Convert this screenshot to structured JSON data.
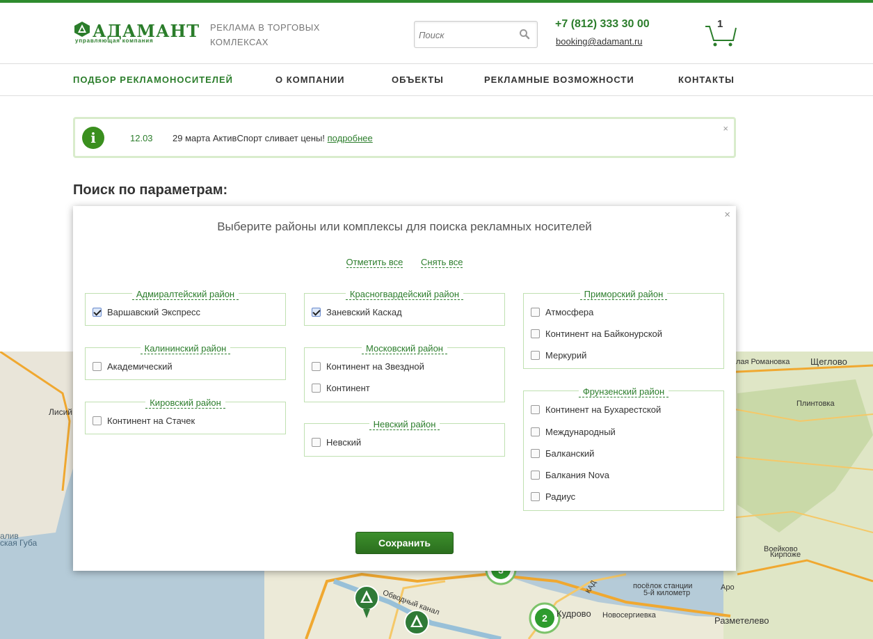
{
  "header": {
    "logo_name": "АДАМАНТ",
    "logo_sub": "управляющая компания",
    "tagline": "РЕКЛАМА В ТОРГОВЫХ КОМЛЕКСАХ",
    "search_placeholder": "Поиск",
    "phone": "+7 (812) 333 30 00",
    "email": "booking@adamant.ru",
    "cart_count": "1"
  },
  "nav": {
    "items": [
      {
        "label": "ПОДБОР РЕКЛАМОНОСИТЕЛЕЙ",
        "active": true
      },
      {
        "label": "О КОМПАНИИ",
        "active": false
      },
      {
        "label": "ОБЪЕКТЫ",
        "active": false
      },
      {
        "label": "РЕКЛАМНЫЕ ВОЗМОЖНОСТИ",
        "active": false
      },
      {
        "label": "КОНТАКТЫ",
        "active": false
      }
    ]
  },
  "notice": {
    "icon": "i",
    "date": "12.03",
    "message": "29 марта АктивСпорт сливает цены!",
    "more_link": "подробнее",
    "close": "×"
  },
  "section_title": "Поиск по параметрам:",
  "modal": {
    "close": "×",
    "title": "Выберите районы или комплексы для поиска рекламных носителей",
    "select_all": "Отметить все",
    "clear_all": "Снять все",
    "save_label": "Сохранить",
    "groups": [
      {
        "name": "Адмиралтейский район",
        "items": [
          {
            "label": "Варшавский Экспресс",
            "checked": true
          }
        ]
      },
      {
        "name": "Калининский район",
        "items": [
          {
            "label": "Академический",
            "checked": false
          }
        ]
      },
      {
        "name": "Кировский район",
        "items": [
          {
            "label": "Континент на Стачек",
            "checked": false
          }
        ]
      },
      {
        "name": "Красногвардейский район",
        "items": [
          {
            "label": "Заневский Каскад",
            "checked": true
          }
        ]
      },
      {
        "name": "Московский район",
        "items": [
          {
            "label": "Континент на Звездной",
            "checked": false
          },
          {
            "label": "Континент",
            "checked": false
          }
        ]
      },
      {
        "name": "Невский район",
        "items": [
          {
            "label": "Невский",
            "checked": false
          }
        ]
      },
      {
        "name": "Приморский район",
        "items": [
          {
            "label": "Атмосфера",
            "checked": false
          },
          {
            "label": "Континент на Байконурской",
            "checked": false
          },
          {
            "label": "Меркурий",
            "checked": false
          }
        ]
      },
      {
        "name": "Фрунзенский район",
        "items": [
          {
            "label": "Континент на Бухарестской",
            "checked": false
          },
          {
            "label": "Международный",
            "checked": false
          },
          {
            "label": "Балканский",
            "checked": false
          },
          {
            "label": "Балкания Nova",
            "checked": false
          },
          {
            "label": "Радиус",
            "checked": false
          }
        ]
      }
    ]
  },
  "map": {
    "labels": [
      "Лисий",
      "алив",
      "ская Губа",
      "Щеглово",
      "лая Романовка",
      "Плинтовка",
      "Воейково",
      "Кирпоже",
      "посёлок станции",
      "5-й километр",
      "Кудрово",
      "Новосергиевка",
      "Разметелево",
      "Обводный канал",
      "Аро",
      "КАД",
      "2",
      "3"
    ]
  },
  "colors": {
    "brand_green": "#2b7d2b",
    "light_green_border": "#bfe0b0",
    "button_green": "#3c8f2c"
  }
}
